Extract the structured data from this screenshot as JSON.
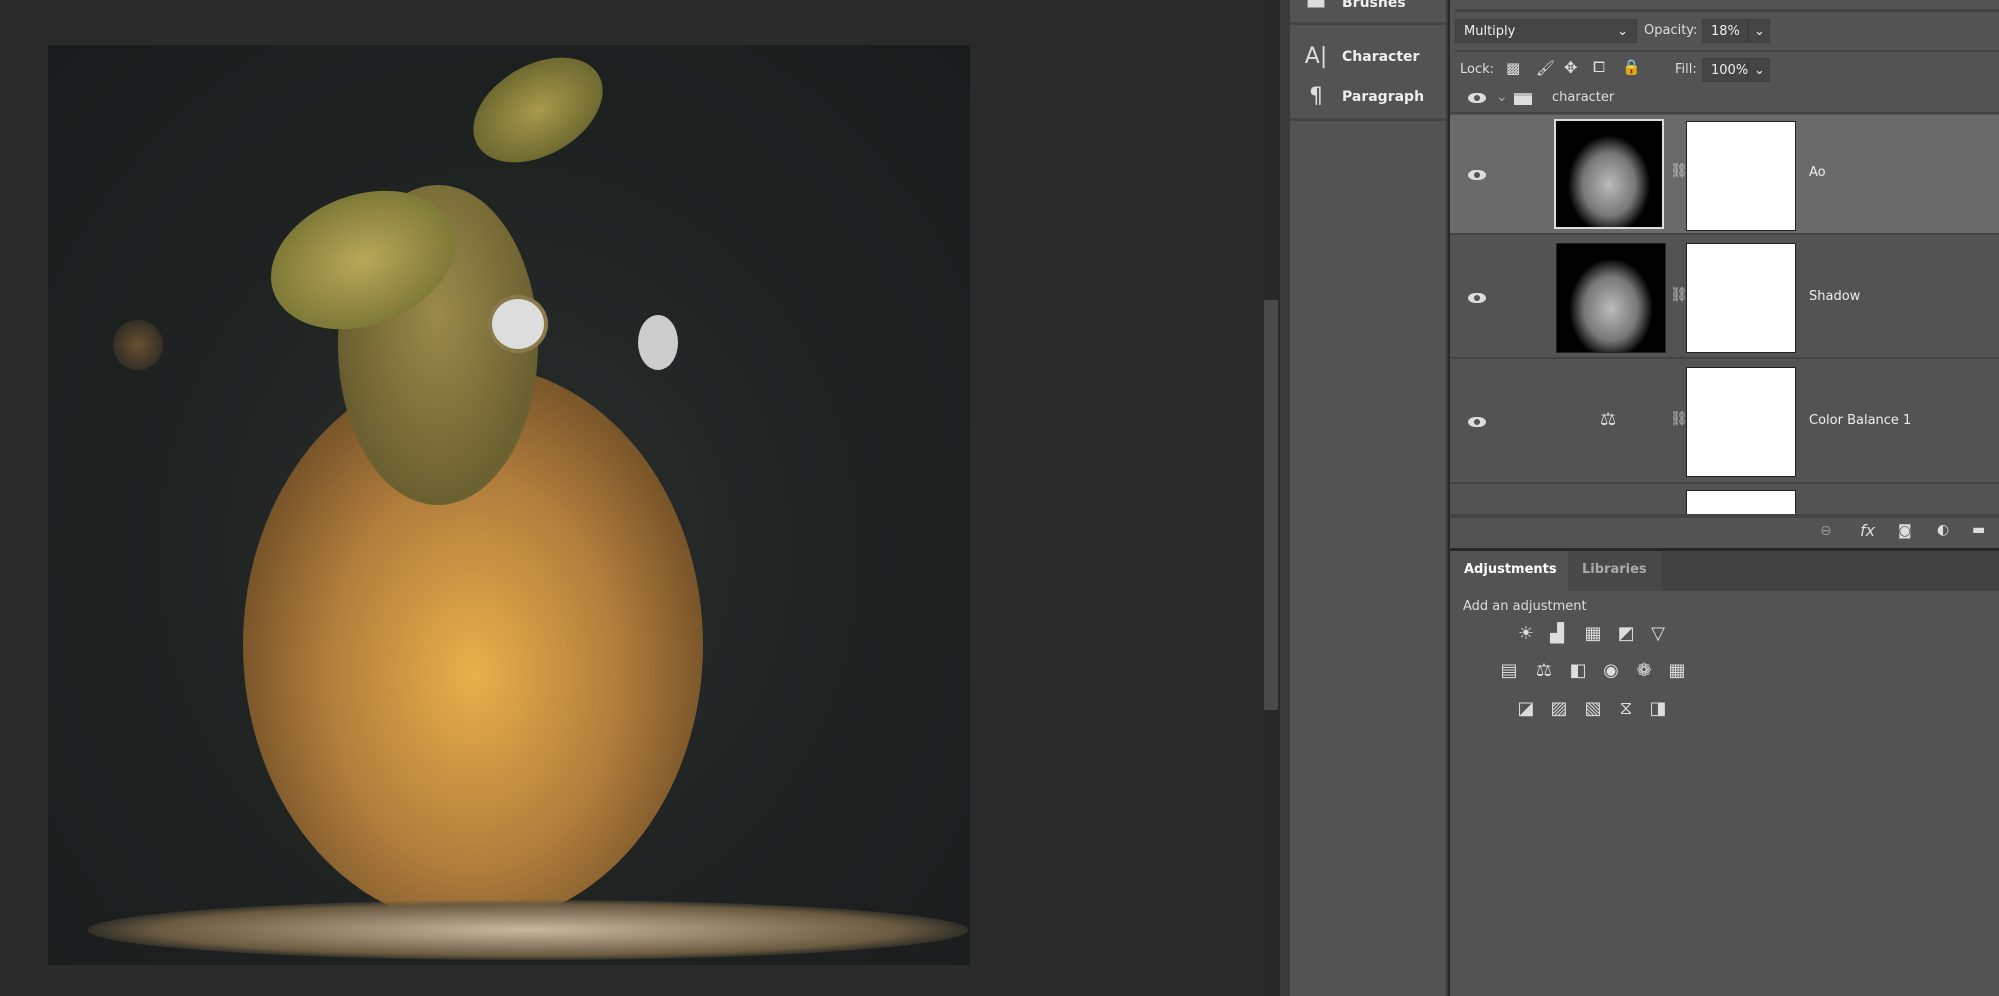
{
  "tool_panel": {
    "items": [
      {
        "label": "Brushes",
        "icon": "brush-icon"
      },
      {
        "label": "Character",
        "icon": "character-icon"
      },
      {
        "label": "Paragraph",
        "icon": "paragraph-icon"
      }
    ]
  },
  "layers": {
    "blend_mode": "Multiply",
    "opacity_label": "Opacity:",
    "opacity": "18%",
    "lock_label": "Lock:",
    "fill_label": "Fill:",
    "fill": "100%",
    "group": {
      "name": "character"
    },
    "rows": [
      {
        "name": "Ao",
        "selected": true
      },
      {
        "name": "Shadow"
      },
      {
        "name": "Color Balance 1"
      }
    ]
  },
  "adjustments": {
    "tabs": [
      {
        "label": "Adjustments",
        "active": true
      },
      {
        "label": "Libraries"
      }
    ],
    "hint": "Add an adjustment"
  },
  "colors": {
    "panel": "#535353",
    "selected_row": "#6a6a6a",
    "canvas_bg": "#2a2a2a"
  }
}
